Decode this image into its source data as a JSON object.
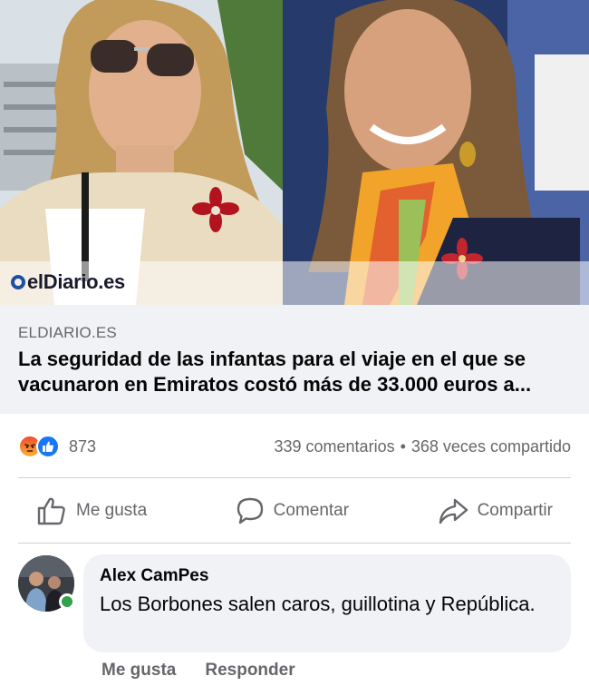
{
  "post_link": {
    "source_logo_text": "elDiario.es",
    "domain": "ELDIARIO.ES",
    "headline": "La seguridad de las infantas para el viaje en el que se vacunaron en Emiratos costó más de 33.000 euros a..."
  },
  "stats": {
    "reaction_count": "873",
    "comments": "339 comentarios",
    "separator": "•",
    "shares": "368 veces compartido"
  },
  "actions": {
    "like": "Me gusta",
    "comment": "Comentar",
    "share": "Compartir"
  },
  "comment": {
    "author": "Alex CamPes",
    "text": "Los Borbones salen caros, guillotina y República.",
    "like_label": "Me gusta",
    "reply_label": "Responder"
  },
  "colors": {
    "facebook_blue": "#1877f2",
    "secondary_text": "#65676b",
    "bubble_bg": "#f0f2f5",
    "online_green": "#31a24c"
  },
  "icons": [
    "angry-reaction-icon",
    "like-reaction-icon",
    "thumbs-up-icon",
    "speech-bubble-icon",
    "share-arrow-icon"
  ]
}
